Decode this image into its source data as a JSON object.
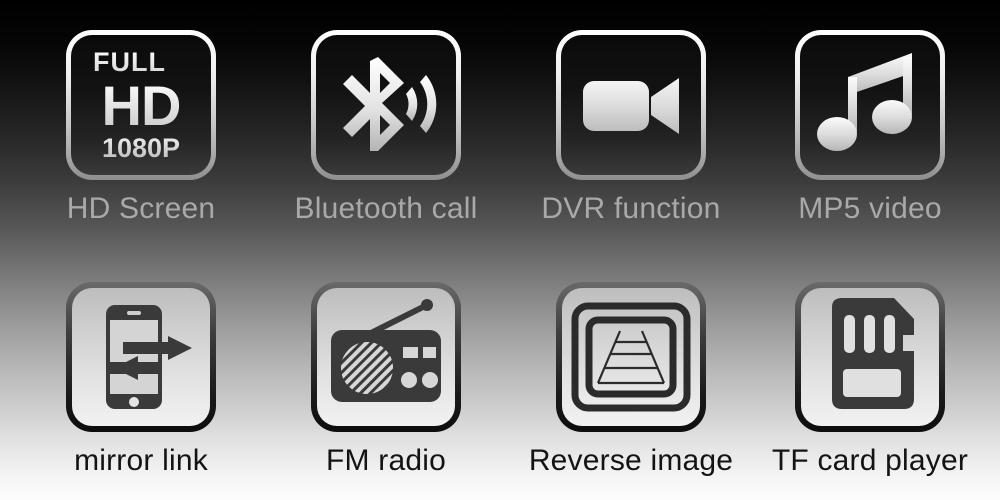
{
  "page": {
    "title": "Car multimedia player feature icons",
    "background_top_color": "#000000",
    "background_bottom_color": "#ffffff"
  },
  "features": [
    {
      "id": "hd-screen",
      "label": "HD Screen",
      "icon": "full-hd-1080p-icon",
      "row": "top",
      "icon_text": {
        "full": "FULL",
        "hd": "HD",
        "resolution": "1080P"
      },
      "label_color": "#a9a9a9"
    },
    {
      "id": "bluetooth-call",
      "label": "Bluetooth call",
      "icon": "bluetooth-signal-icon",
      "row": "top",
      "label_color": "#a9a9a9"
    },
    {
      "id": "dvr-function",
      "label": "DVR function",
      "icon": "video-camera-icon",
      "row": "top",
      "label_color": "#a9a9a9"
    },
    {
      "id": "mp5-video",
      "label": "MP5 video",
      "icon": "music-note-icon",
      "row": "top",
      "label_color": "#a9a9a9"
    },
    {
      "id": "mirror-link",
      "label": "mirror link",
      "icon": "phone-mirror-arrows-icon",
      "row": "bottom",
      "label_color": "#141414"
    },
    {
      "id": "fm-radio",
      "label": "FM radio",
      "icon": "radio-receiver-icon",
      "row": "bottom",
      "label_color": "#141414"
    },
    {
      "id": "reverse-image",
      "label": "Reverse image",
      "icon": "rear-view-camera-icon",
      "row": "bottom",
      "label_color": "#141414"
    },
    {
      "id": "tf-card-player",
      "label": "TF card player",
      "icon": "tf-memory-card-icon",
      "row": "bottom",
      "label_color": "#141414"
    }
  ]
}
